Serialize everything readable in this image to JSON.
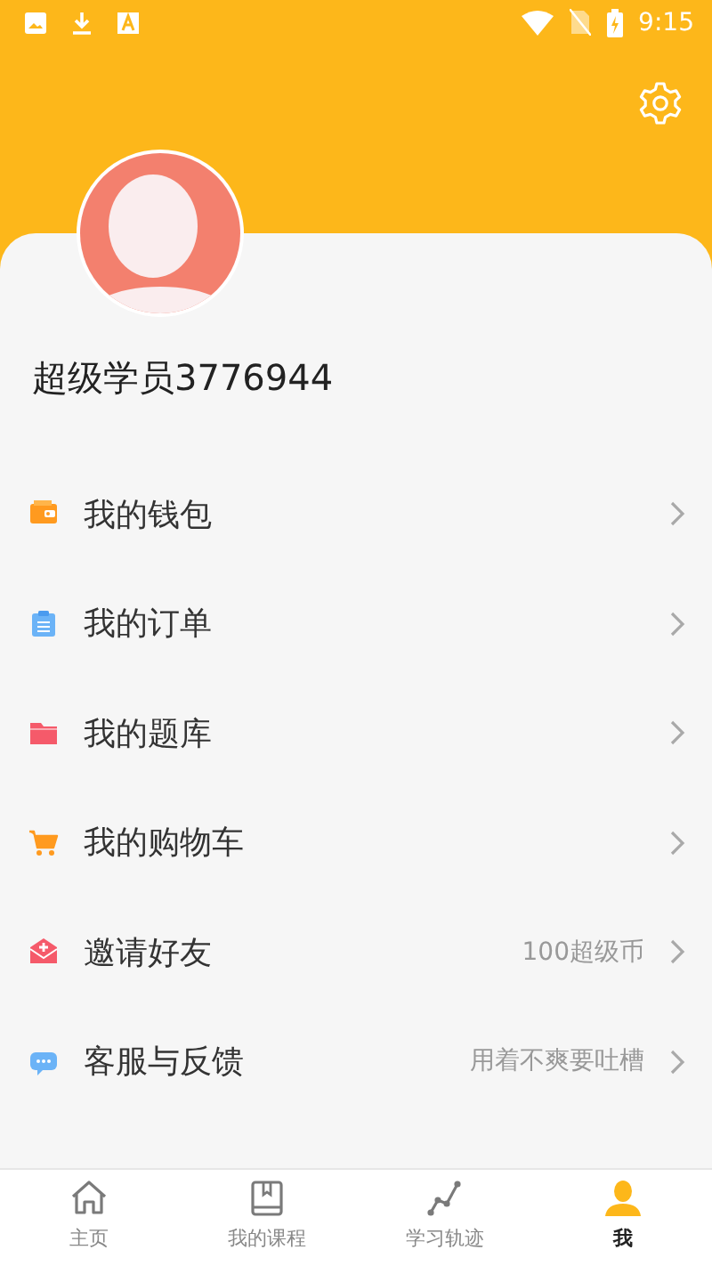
{
  "status_bar": {
    "time": "9:15"
  },
  "profile": {
    "name": "超级学员3776944"
  },
  "menu": [
    {
      "kind": "wallet",
      "label": "我的钱包"
    },
    {
      "kind": "order",
      "label": "我的订单"
    },
    {
      "kind": "folder",
      "label": "我的题库"
    },
    {
      "kind": "cart",
      "label": "我的购物车"
    },
    {
      "kind": "invite",
      "label": "邀请好友",
      "detail": "100超级币"
    },
    {
      "kind": "service",
      "label": "客服与反馈",
      "detail": "用着不爽要吐槽"
    }
  ],
  "tabs": [
    {
      "kind": "home",
      "label": "主页",
      "selected": false
    },
    {
      "kind": "course",
      "label": "我的课程",
      "selected": false
    },
    {
      "kind": "track",
      "label": "学习轨迹",
      "selected": false
    },
    {
      "kind": "me",
      "label": "我",
      "selected": true
    }
  ]
}
